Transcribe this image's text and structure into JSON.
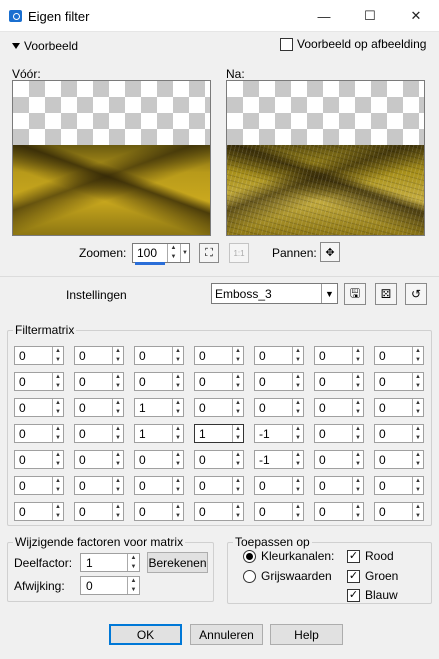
{
  "window": {
    "title": "Eigen filter",
    "minimize_glyph": "—",
    "maximize_glyph": "☐",
    "close_glyph": "✕"
  },
  "preview": {
    "toggle_label": "Voorbeeld",
    "on_image_label": "Voorbeeld op afbeelding",
    "on_image_checked": false,
    "before_label": "Vóór:",
    "after_label": "Na:"
  },
  "zoom": {
    "label": "Zoomen:",
    "value": "100",
    "pan_label": "Pannen:"
  },
  "settings": {
    "label": "Instellingen",
    "preset": "Emboss_3"
  },
  "filtermatrix": {
    "title": "Filtermatrix",
    "rows": [
      [
        "0",
        "0",
        "0",
        "0",
        "0",
        "0",
        "0"
      ],
      [
        "0",
        "0",
        "0",
        "0",
        "0",
        "0",
        "0"
      ],
      [
        "0",
        "0",
        "1",
        "0",
        "0",
        "0",
        "0"
      ],
      [
        "0",
        "0",
        "1",
        "1",
        "-1",
        "0",
        "0"
      ],
      [
        "0",
        "0",
        "0",
        "0",
        "-1",
        "0",
        "0"
      ],
      [
        "0",
        "0",
        "0",
        "0",
        "0",
        "0",
        "0"
      ],
      [
        "0",
        "0",
        "0",
        "0",
        "0",
        "0",
        "0"
      ]
    ]
  },
  "factors": {
    "title": "Wijzigende factoren voor matrix",
    "divisor_label": "Deelfactor:",
    "divisor_value": "1",
    "compute_button": "Berekenen",
    "bias_label": "Afwijking:",
    "bias_value": "0"
  },
  "apply_to": {
    "title": "Toepassen op",
    "color_channels": "Kleurkanalen:",
    "grayscale": "Grijswaarden",
    "red": "Rood",
    "green": "Groen",
    "blue": "Blauw",
    "selected": "color_channels",
    "red_checked": true,
    "green_checked": true,
    "blue_checked": true
  },
  "buttons": {
    "ok": "OK",
    "cancel": "Annuleren",
    "help": "Help"
  }
}
